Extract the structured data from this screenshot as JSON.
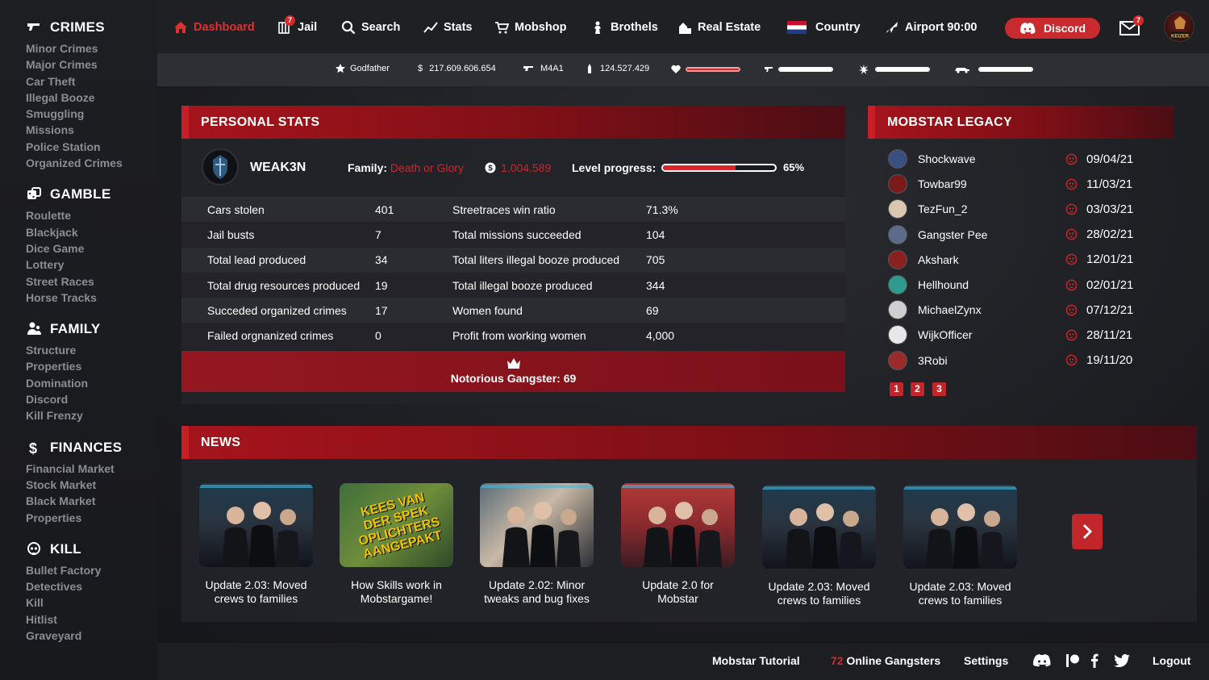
{
  "sidebar": {
    "sections": [
      {
        "title": "CRIMES",
        "icon": "gun-icon",
        "items": [
          "Minor Crimes",
          "Major Crimes",
          "Car Theft",
          "Illegal Booze",
          "Smuggling",
          "Missions",
          "Police Station",
          "Organized Crimes"
        ]
      },
      {
        "title": "GAMBLE",
        "icon": "dice-icon",
        "items": [
          "Roulette",
          "Blackjack",
          "Dice Game",
          "Lottery",
          "Street Races",
          "Horse Tracks"
        ]
      },
      {
        "title": "FAMILY",
        "icon": "family-icon",
        "items": [
          "Structure",
          "Properties",
          "Domination",
          "Discord",
          "Kill Frenzy"
        ]
      },
      {
        "title": "FINANCES",
        "icon": "dollar-icon",
        "items": [
          "Financial Market",
          "Stock Market",
          "Black Market",
          "Properties"
        ]
      },
      {
        "title": "KILL",
        "icon": "skull-icon",
        "items": [
          "Bullet Factory",
          "Detectives",
          "Kill",
          "Hitlist",
          "Graveyard"
        ]
      }
    ]
  },
  "nav": {
    "dashboard": "Dashboard",
    "jail": "Jail",
    "jail_badge": "7",
    "search": "Search",
    "stats": "Stats",
    "mobshop": "Mobshop",
    "brothels": "Brothels",
    "real_estate": "Real Estate",
    "country": "Country",
    "airport": "Airport",
    "airport_time": "90:00",
    "discord": "Discord",
    "mail_badge": "7",
    "avatar_text": "KEIZER"
  },
  "status": {
    "rank": "Godfather",
    "money": "217.609.606.654",
    "weapon": "M4A1",
    "bullets": "124.527.429",
    "health": 1.0,
    "weapon_bar": 1.0,
    "drugs_bar": 1.0,
    "car_bar": 1.0
  },
  "personal": {
    "heading": "PERSONAL STATS",
    "username": "WEAK3N",
    "family_label": "Family:",
    "family_value": "Death or Glory",
    "cash": "1.004.589",
    "level_label": "Level progress:",
    "level_progress": 65,
    "level_pct": "65%",
    "stats": [
      {
        "l1": "Cars stolen",
        "v1": "401",
        "l2": "Streetraces win ratio",
        "v2": "71.3%"
      },
      {
        "l1": "Jail busts",
        "v1": "7",
        "l2": "Total missions succeeded",
        "v2": "104"
      },
      {
        "l1": "Total lead produced",
        "v1": "34",
        "l2": "Total liters illegal booze produced",
        "v2": "705"
      },
      {
        "l1": "Total drug resources produced",
        "v1": "19",
        "l2": "Total illegal booze produced",
        "v2": "344"
      },
      {
        "l1": "Succeded organized crimes",
        "v1": "17",
        "l2": "Women found",
        "v2": "69"
      },
      {
        "l1": "Failed orgnanized crimes",
        "v1": "0",
        "l2": "Profit from working women",
        "v2": "4,000"
      }
    ],
    "notorious": "Notorious Gangster: 69"
  },
  "legacy": {
    "heading": "MOBSTAR LEGACY",
    "rows": [
      {
        "name": "Shockwave",
        "date": "09/04/21",
        "color": "#3b4f82"
      },
      {
        "name": "Towbar99",
        "date": "11/03/21",
        "color": "#7a1a1a"
      },
      {
        "name": "TezFun_2",
        "date": "03/03/21",
        "color": "#d9c7b0"
      },
      {
        "name": "Gangster Pee",
        "date": "28/02/21",
        "color": "#5d6b8a"
      },
      {
        "name": "Akshark",
        "date": "12/01/21",
        "color": "#8a2020"
      },
      {
        "name": "Hellhound",
        "date": "02/01/21",
        "color": "#2f9b8e"
      },
      {
        "name": "MichaelZynx",
        "date": "07/12/21",
        "color": "#cfcfcf"
      },
      {
        "name": "WijkOfficer",
        "date": "28/11/21",
        "color": "#e8e8e8"
      },
      {
        "name": "3Robi",
        "date": "19/11/20",
        "color": "#9b2a2a"
      }
    ],
    "pages": [
      "1",
      "2",
      "3"
    ]
  },
  "news": {
    "heading": "NEWS",
    "items": [
      {
        "title": "Update 2.03: Moved crews to families"
      },
      {
        "title": "How Skills work in Mobstargame!",
        "thumb_text": "KEES VAN DER SPEK OPLICHTERS AANGEPAKT"
      },
      {
        "title": "Update 2.02: Minor tweaks and bug fixes"
      },
      {
        "title": "Update 2.0 for Mobstar"
      },
      {
        "title": "Update 2.03: Moved crews to families"
      },
      {
        "title": "Update 2.03: Moved crews to families"
      }
    ]
  },
  "footer": {
    "tutorial": "Mobstar Tutorial",
    "online_count": "72",
    "online_label": " Online Gangsters",
    "settings": "Settings",
    "logout": "Logout"
  },
  "colors": {
    "accent": "#c92a2d",
    "panel": "#232429",
    "text_muted": "#8b8d94"
  }
}
